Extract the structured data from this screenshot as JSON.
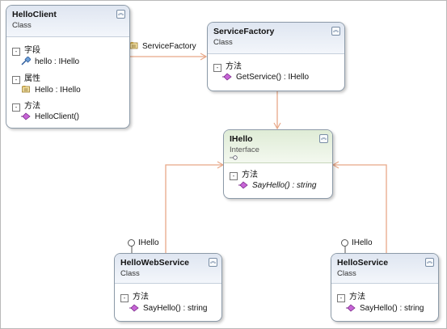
{
  "colors": {
    "connector": "#e8a888",
    "box_border": "#8c9aa8",
    "class_header": "#dfe6f1",
    "interface_header": "#dfecd6"
  },
  "classes": {
    "hello_client": {
      "name": "HelloClient",
      "kind": "Class",
      "sections": [
        {
          "title": "字段",
          "members": [
            {
              "text": "hello : IHello",
              "icon": "field-icon"
            }
          ]
        },
        {
          "title": "属性",
          "members": [
            {
              "text": "Hello : IHello",
              "icon": "property-icon"
            }
          ]
        },
        {
          "title": "方法",
          "members": [
            {
              "text": "HelloClient()",
              "icon": "method-icon"
            }
          ]
        }
      ]
    },
    "service_factory": {
      "name": "ServiceFactory",
      "kind": "Class",
      "sections": [
        {
          "title": "方法",
          "members": [
            {
              "text": "GetService() : IHello",
              "icon": "method-icon"
            }
          ]
        }
      ]
    },
    "ihello": {
      "name": "IHello",
      "kind": "Interface",
      "sections": [
        {
          "title": "方法",
          "members": [
            {
              "text": "SayHello() : string",
              "icon": "method-icon"
            }
          ]
        }
      ]
    },
    "hello_web_service": {
      "name": "HelloWebService",
      "kind": "Class",
      "sections": [
        {
          "title": "方法",
          "members": [
            {
              "text": "SayHello() : string",
              "icon": "method-icon"
            }
          ]
        }
      ]
    },
    "hello_service": {
      "name": "HelloService",
      "kind": "Class",
      "sections": [
        {
          "title": "方法",
          "members": [
            {
              "text": "SayHello() : string",
              "icon": "method-icon"
            }
          ]
        }
      ]
    }
  },
  "connectors": {
    "association_label": "ServiceFactory",
    "lollipop_web": "IHello",
    "lollipop_service": "IHello"
  }
}
